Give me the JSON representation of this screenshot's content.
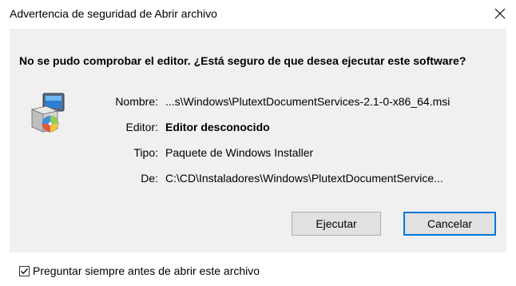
{
  "window": {
    "title": "Advertencia de seguridad de Abrir archivo",
    "close_symbol": "×"
  },
  "dialog": {
    "question": "No se pudo comprobar el editor. ¿Está seguro de que desea ejecutar este software?",
    "icon": "windows-installer-package-icon",
    "fields": [
      {
        "label": "Nombre:",
        "value": "...s\\Windows\\PlutextDocumentServices-2.1-0-x86_64.msi"
      },
      {
        "label": "Editor:",
        "value": "Editor desconocido"
      },
      {
        "label": "Tipo:",
        "value": "Paquete de Windows Installer"
      },
      {
        "label": "De:",
        "value": "C:\\CD\\Instaladores\\Windows\\PlutextDocumentService..."
      }
    ]
  },
  "buttons": {
    "run_label": "Ejecutar",
    "cancel_label": "Cancelar"
  },
  "footer": {
    "checkbox_label": "Preguntar siempre antes de abrir este archivo",
    "checkbox_checked": true
  },
  "colors": {
    "content_bg": "#f0f0f0",
    "button_bg": "#e1e1e1",
    "button_border": "#adadad",
    "default_button_border": "#0078d7"
  }
}
